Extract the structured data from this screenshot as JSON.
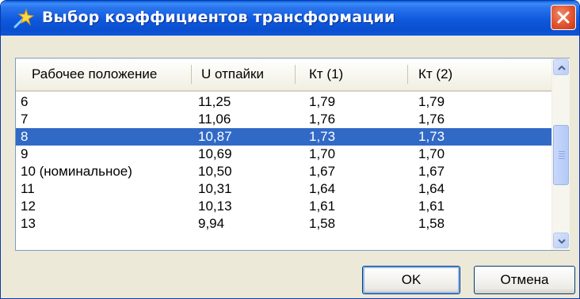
{
  "window": {
    "title": "Выбор коэффициентов трансформации"
  },
  "table": {
    "columns": [
      "Рабочее положение",
      "U отпайки",
      "Кт (1)",
      "Кт (2)"
    ],
    "rows": [
      [
        "6",
        "11,25",
        "1,79",
        "1,79"
      ],
      [
        "7",
        "11,06",
        "1,76",
        "1,76"
      ],
      [
        "8",
        "10,87",
        "1,73",
        "1,73"
      ],
      [
        "9",
        "10,69",
        "1,70",
        "1,70"
      ],
      [
        "10 (номинальное)",
        "10,50",
        "1,67",
        "1,67"
      ],
      [
        "11",
        "10,31",
        "1,64",
        "1,64"
      ],
      [
        "12",
        "10,13",
        "1,61",
        "1,61"
      ],
      [
        "13",
        "9,94",
        "1,58",
        "1,58"
      ]
    ],
    "selected_row": "8"
  },
  "buttons": {
    "ok": "OK",
    "cancel": "Отмена"
  },
  "colors": {
    "titlebar": "#0a4fd0",
    "selection": "#3169c6",
    "dialog_bg": "#ece9d8",
    "close": "#e2532f"
  },
  "icons": {
    "title": "sparkle-wand-icon",
    "close": "close-icon",
    "scroll_up": "chevron-up-icon",
    "scroll_down": "chevron-down-icon"
  }
}
